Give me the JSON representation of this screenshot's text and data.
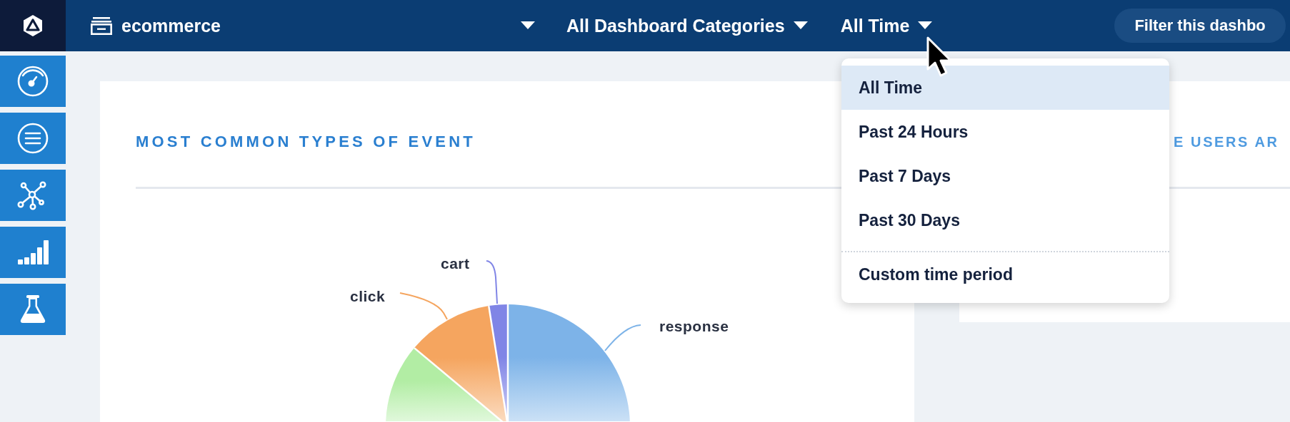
{
  "top_bar": {
    "dashboard": "ecommerce",
    "categories": "All Dashboard Categories",
    "time_range": "All Time",
    "filter_button": "Filter this dashbo"
  },
  "time_menu": {
    "items": [
      {
        "label": "All Time",
        "kind": "preset",
        "selected": true
      },
      {
        "label": "Past 24 Hours",
        "kind": "preset",
        "selected": false
      },
      {
        "label": "Past 7 Days",
        "kind": "preset",
        "selected": false
      },
      {
        "label": "Past 30 Days",
        "kind": "preset",
        "selected": false
      },
      {
        "label": "Custom time period",
        "kind": "custom",
        "selected": false
      }
    ]
  },
  "cards": [
    {
      "title": "MOST COMMON TYPES OF EVENT",
      "pie": {
        "slices": [
          {
            "label": "response",
            "color": "#7db3e8"
          },
          {
            "color": "#b2eda4"
          },
          {
            "label": "click",
            "color": "#f5a55f"
          },
          {
            "label": "cart",
            "color": "#8085e6"
          }
        ]
      }
    },
    {
      "title": "E USERS AR"
    }
  ]
}
